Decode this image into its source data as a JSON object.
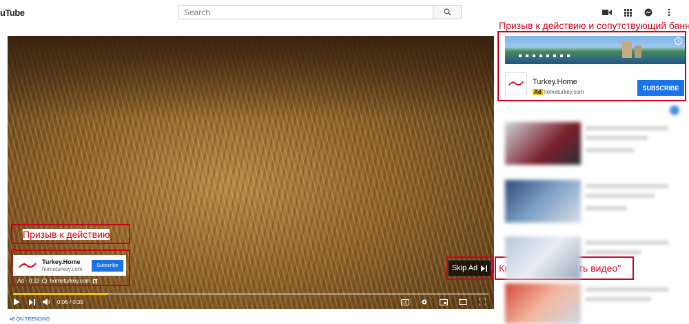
{
  "header": {
    "logo": "uTube",
    "search_placeholder": "Search"
  },
  "player": {
    "cta_card": {
      "title": "Turkey.Home",
      "domain": "hometurkey.com",
      "button": "Subscribe"
    },
    "ad_info": {
      "ad_label": "Ad · 0:23",
      "domain": "hometurkey.com"
    },
    "skip_label": "Skip Ad",
    "time": "0:06 / 0:30",
    "progress": 0.2
  },
  "companion_banner": {
    "title": "Turkey.Home",
    "badge": "Ad",
    "domain": "hometurkey.com",
    "button": "SUBSCRIBE"
  },
  "annotations": {
    "cta": "Призыв к действию",
    "skip": "Кнопка \"Пропустить видео\"",
    "banner": "Призыв к действию и сопутствующий баннер."
  },
  "footer": {
    "trending": "#6 ON TRENDING"
  },
  "colors": {
    "accent_blue": "#1a73e8",
    "annotation_red": "#d0021b",
    "ad_yellow": "#f2c300"
  }
}
